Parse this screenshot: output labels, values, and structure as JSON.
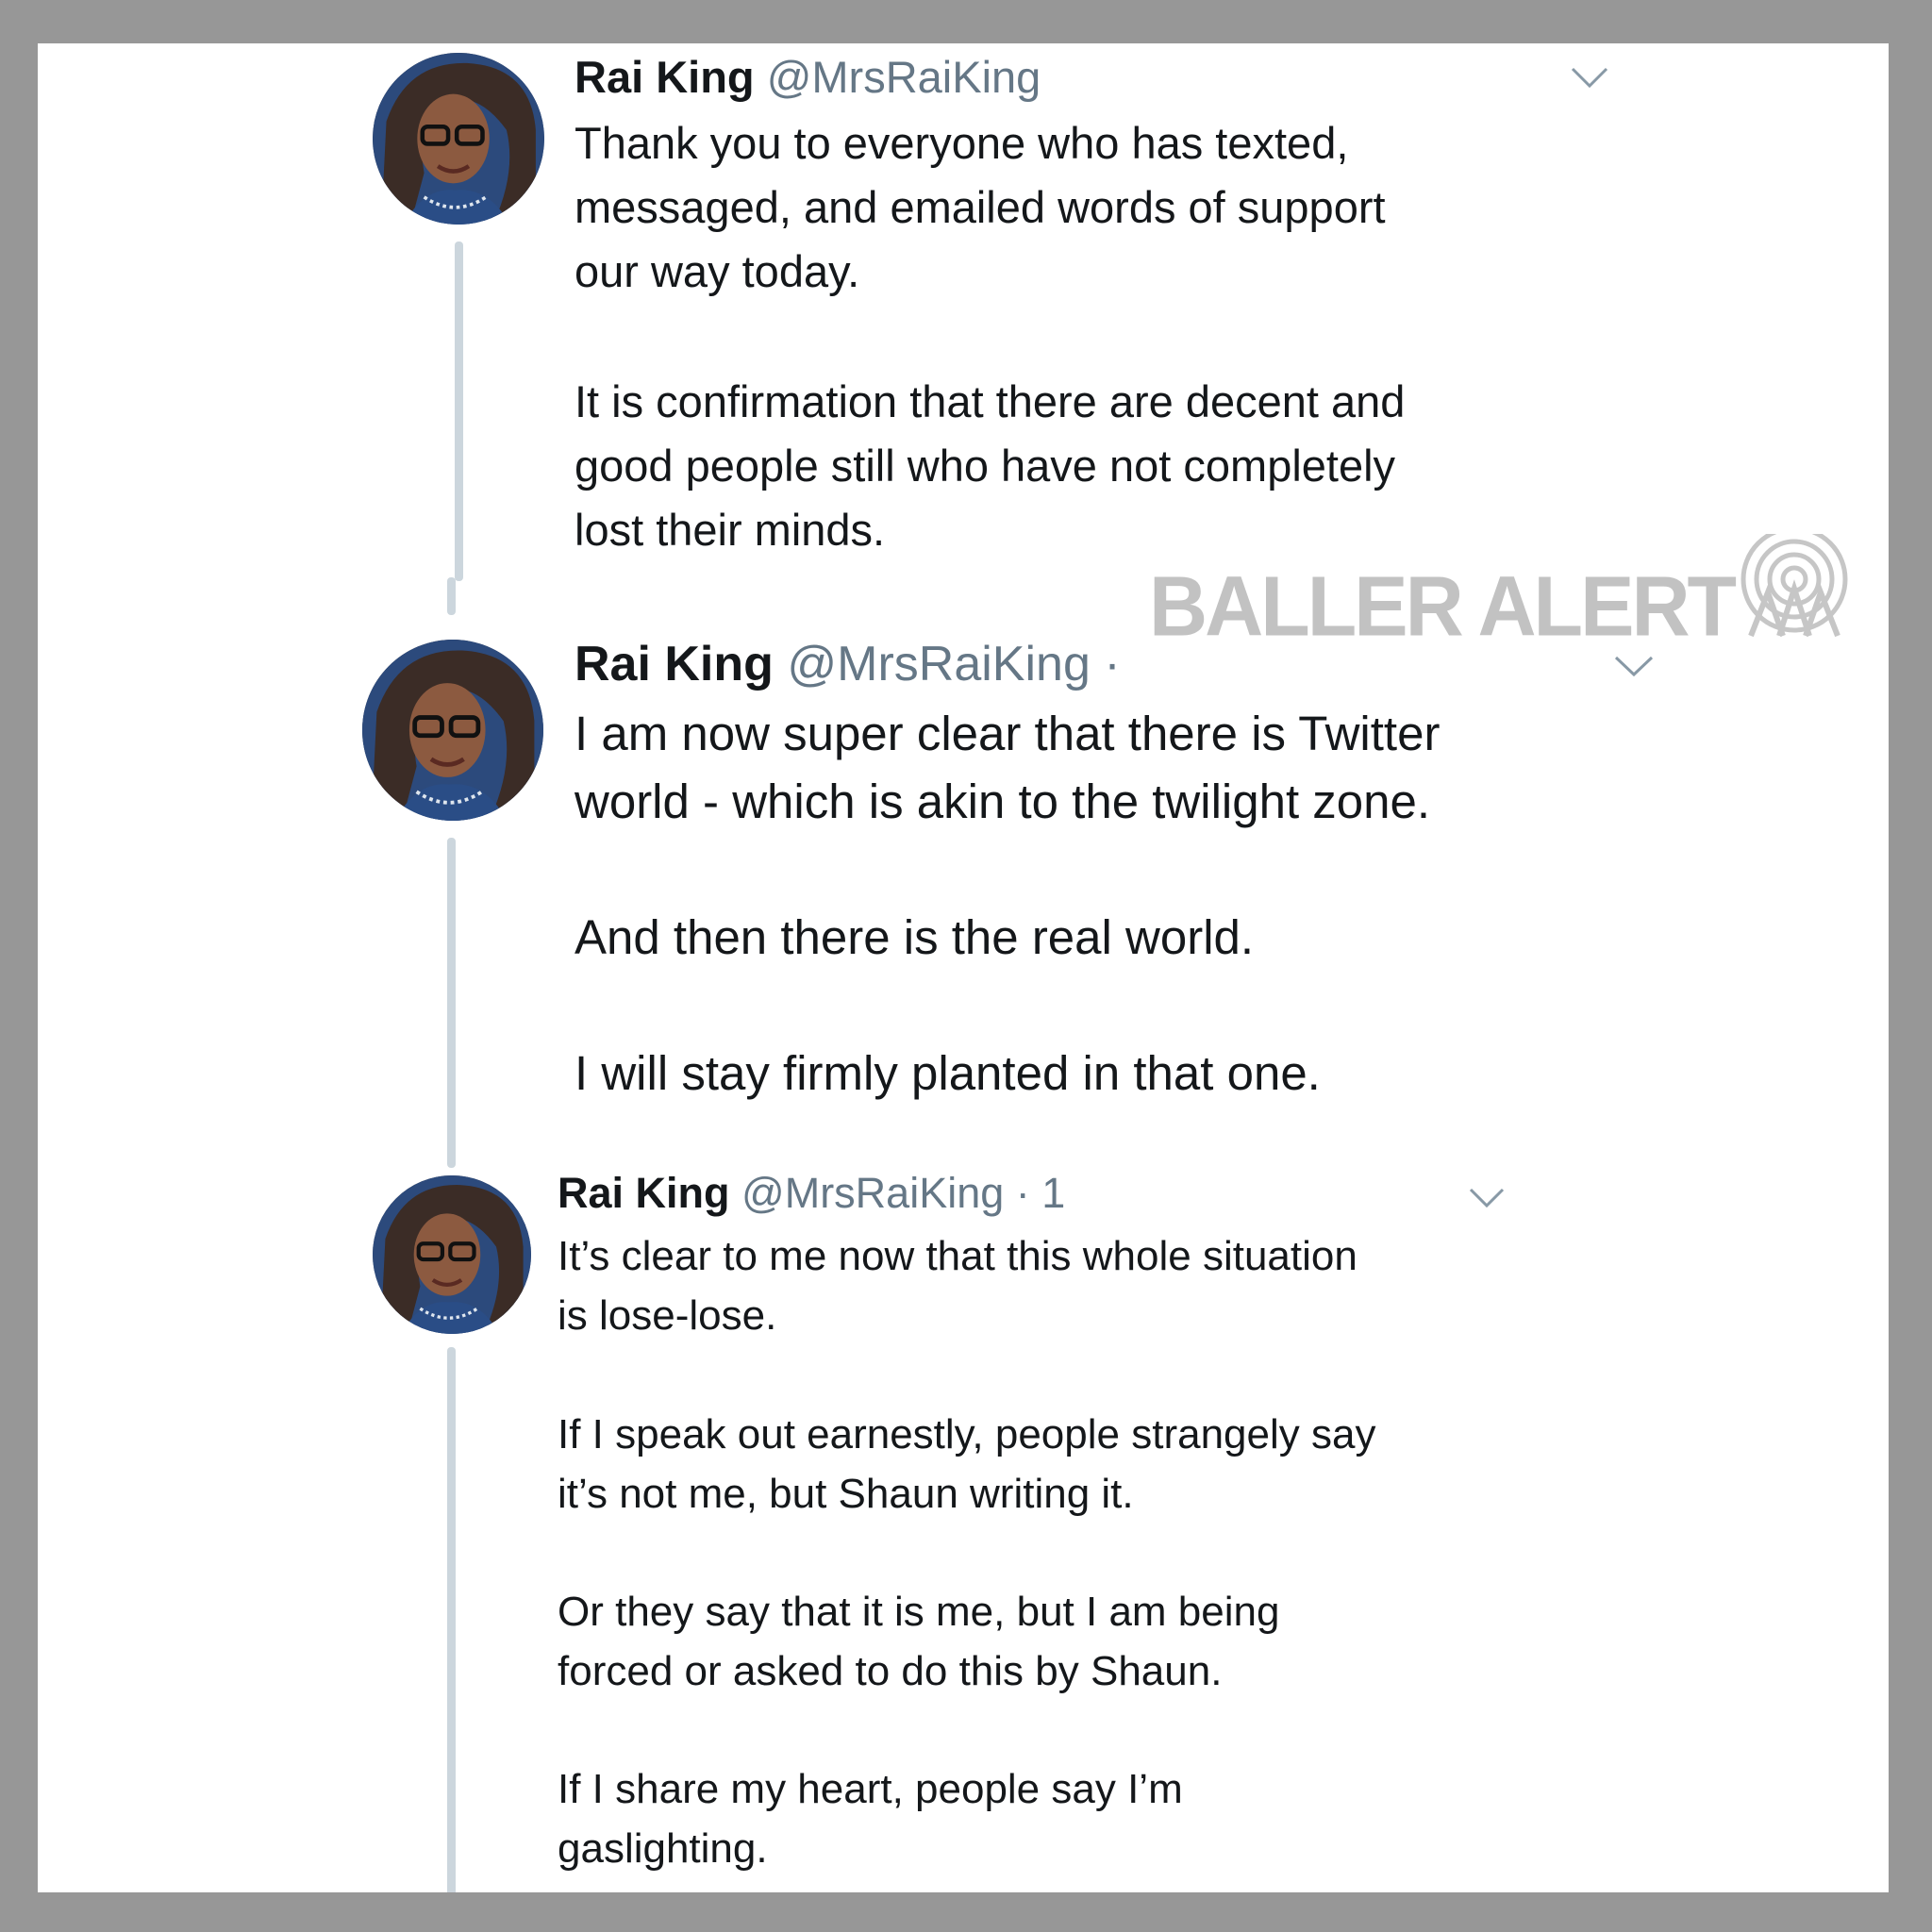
{
  "watermark": {
    "text": "BALLER ALERT"
  },
  "tweets": [
    {
      "name": "Rai King",
      "handle": "@MrsRaiKing",
      "time": "",
      "paragraphs": [
        "Thank you to everyone who has texted,\nmessaged, and emailed words of support\nour way today.",
        "It is confirmation that there are decent and\ngood people still who have not completely\nlost their minds."
      ]
    },
    {
      "name": "Rai King",
      "handle": "@MrsRaiKing",
      "time": "· ",
      "paragraphs": [
        "I am now super clear that there is Twitter\nworld - which is akin to the twilight zone.",
        "And then there is the real world.",
        "I will stay firmly planted in that one."
      ]
    },
    {
      "name": "Rai King",
      "handle": "@MrsRaiKing",
      "time": "· 1",
      "paragraphs": [
        "It’s clear to me now that this whole situation\nis lose-lose.",
        "If I speak out earnestly, people strangely say\nit’s not me, but Shaun writing it.",
        "Or they say that it is me, but I am being\nforced or asked to do this by Shaun.",
        "If I share my heart, people say I’m\ngaslighting."
      ]
    }
  ],
  "icons": {
    "caret": "chevron-down-icon",
    "avatar": "profile-photo",
    "watermark_logo": "broadcast-tower-icon"
  },
  "colors": {
    "background": "#979797",
    "card": "#ffffff",
    "text": "#14171a",
    "handle": "#657786",
    "thread_line": "#ccd6dd",
    "watermark": "#c2c2c2"
  }
}
